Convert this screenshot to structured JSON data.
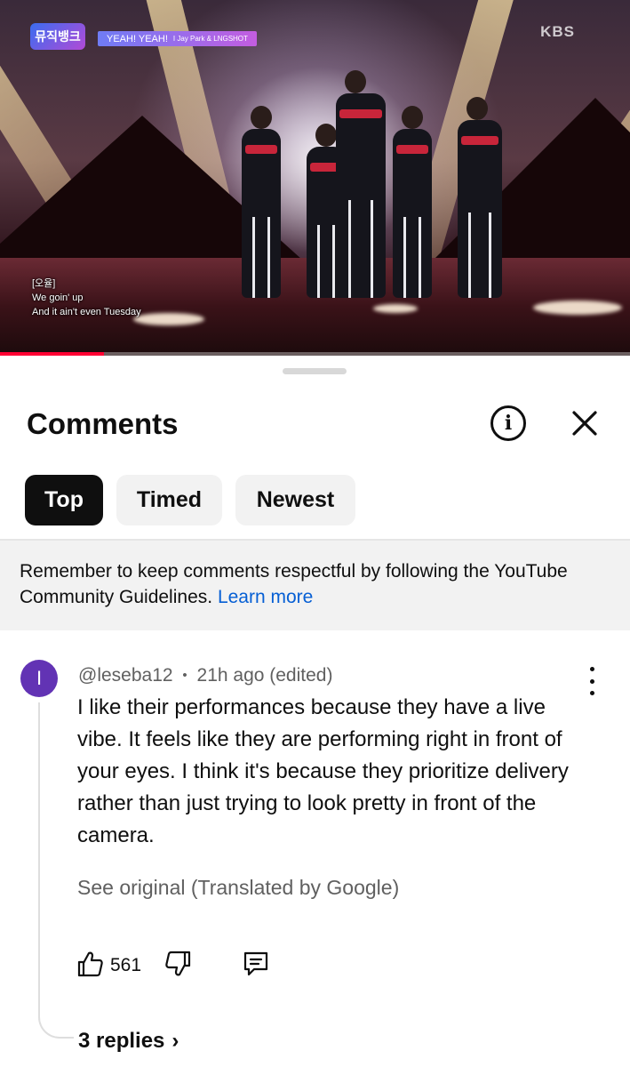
{
  "video": {
    "channel_logo": "뮤직뱅크",
    "song_title": "YEAH! YEAH!",
    "song_artist": "I Jay Park & LNGSHOT",
    "broadcaster": "KBS",
    "subtitle_lines": [
      "[오율]",
      "We goin' up",
      "And it ain't even Tuesday"
    ],
    "progress_fraction": 0.165,
    "progress_color": "#ff0033"
  },
  "comments_sheet": {
    "title": "Comments",
    "info_icon": "info-icon",
    "close_icon": "close-icon",
    "filters": [
      {
        "label": "Top",
        "active": true
      },
      {
        "label": "Timed",
        "active": false
      },
      {
        "label": "Newest",
        "active": false
      }
    ],
    "notice": {
      "text": "Remember to keep comments respectful by following the YouTube Community Guidelines.",
      "link": "Learn more",
      "link_color": "#065fd4"
    }
  },
  "comment": {
    "avatar_letter": "I",
    "avatar_color": "#6233b4",
    "author": "@leseba12",
    "separator": "•",
    "time": "21h ago (edited)",
    "text": "I like their performances because they have a live vibe. It feels like they are performing right in front of your eyes. I think it's because they prioritize delivery rather than just trying to look pretty in front of the camera.",
    "translation_note": "See original (Translated by Google)",
    "likes": "561",
    "replies_label": "3 replies",
    "replies_chevron": "›"
  }
}
